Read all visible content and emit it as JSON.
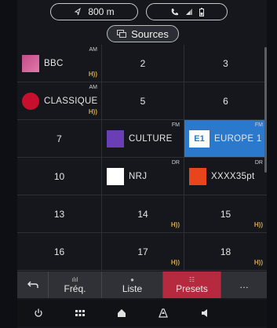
{
  "status": {
    "nav_distance": "800 m"
  },
  "sources_label": "Sources",
  "presets": [
    {
      "num": "",
      "name": "BBC",
      "band": "AM",
      "hd": true,
      "logo": "bbc"
    },
    {
      "num": "2",
      "name": "",
      "band": "",
      "hd": false
    },
    {
      "num": "3",
      "name": "",
      "band": "",
      "hd": false
    },
    {
      "num": "",
      "name": "CLASSIQUE",
      "band": "AM",
      "hd": true,
      "logo": "classique"
    },
    {
      "num": "5",
      "name": "",
      "band": "",
      "hd": false
    },
    {
      "num": "6",
      "name": "",
      "band": "",
      "hd": false
    },
    {
      "num": "7",
      "name": "",
      "band": "",
      "hd": false
    },
    {
      "num": "",
      "name": "CULTURE",
      "band": "FM",
      "hd": false,
      "logo": "culture"
    },
    {
      "num": "",
      "name": "EUROPE 1",
      "band": "FM",
      "hd": false,
      "logo": "europe",
      "selected": true
    },
    {
      "num": "10",
      "name": "",
      "band": "",
      "hd": false
    },
    {
      "num": "",
      "name": "NRJ",
      "band": "DR",
      "hd": false,
      "logo": "nrj"
    },
    {
      "num": "",
      "name": "XXXX35pt",
      "band": "DR",
      "hd": false,
      "logo": "inter"
    },
    {
      "num": "13",
      "name": "",
      "band": "",
      "hd": false
    },
    {
      "num": "14",
      "name": "",
      "band": "",
      "hd": true
    },
    {
      "num": "15",
      "name": "",
      "band": "",
      "hd": true
    },
    {
      "num": "16",
      "name": "",
      "band": "",
      "hd": false
    },
    {
      "num": "17",
      "name": "",
      "band": "",
      "hd": true
    },
    {
      "num": "18",
      "name": "",
      "band": "",
      "hd": true
    }
  ],
  "logo_text": {
    "europe": "E1"
  },
  "hd_label": "H))",
  "tabs": {
    "freq": "Fréq.",
    "liste": "Liste",
    "presets": "Presets",
    "more": "…"
  },
  "colors": {
    "selected": "#2b79cc",
    "active_tab": "#b52a3e",
    "hd": "#d6a64a"
  },
  "icons": [
    "nav-arrow-icon",
    "phone-icon",
    "signal-icon",
    "battery-icon",
    "sources-icon",
    "back-icon",
    "equalizer-icon",
    "list-icon",
    "presets-icon",
    "power-icon",
    "apps-icon",
    "home-icon",
    "navigation-icon",
    "volume-icon"
  ]
}
